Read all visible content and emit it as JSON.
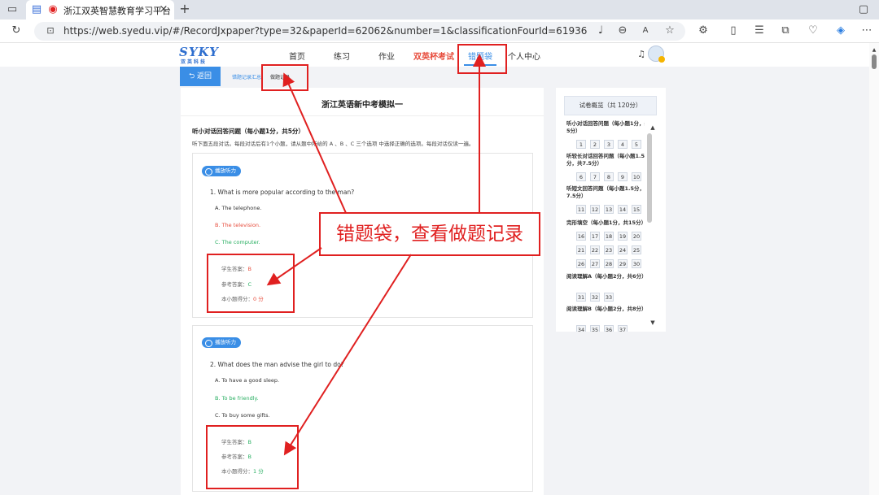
{
  "browser": {
    "tab_title": "浙江双英智慧教育学习平台",
    "new_tab": "+",
    "url": "https://web.syedu.vip/#/RecordJxpaper?type=32&paperId=62062&number=1&classificationFourId=61936"
  },
  "site": {
    "logo": "SYKY",
    "logo_sub": "双英科技",
    "nav": [
      "首页",
      "练习",
      "作业",
      "双英杯考试",
      "错题袋",
      "个人中心"
    ],
    "back_label": "返回",
    "crumb_summary": "错题记录汇总",
    "crumb_record": "做题记录"
  },
  "paper": {
    "title": "浙江英语新中考模拟一",
    "section_title": "听小对话回答问题（每小题1分，共5分）",
    "section_desc": "听下面五段对话。每段对话后有1个小题，请从题中所给的 A 、B 、C 三个选项 中选择正确的选项。每段对话仅读一遍。",
    "play_label": "播放听力",
    "questions": [
      {
        "text": "1. What is more popular according to the man?",
        "options": [
          "A. The telephone.",
          "B. The television.",
          "C. The computer."
        ],
        "student_label": "学生答案：",
        "student_answer": "B",
        "ref_label": "参考答案：",
        "ref_answer": "C",
        "score_label": "本小题得分：",
        "score": "0 分"
      },
      {
        "text": "2. What does the man advise the girl to do?",
        "options": [
          "A. To have a good sleep.",
          "B. To be friendly.",
          "C. To buy some gifts."
        ],
        "student_label": "学生答案：",
        "student_answer": "B",
        "ref_label": "参考答案：",
        "ref_answer": "B",
        "score_label": "本小题得分：",
        "score": "1 分"
      }
    ]
  },
  "panel": {
    "title": "试卷概览（共 120分）",
    "groups": [
      {
        "title": "听小对话回答问题（每小题1分，共5分）",
        "numbers": [
          "1",
          "2",
          "3",
          "4",
          "5"
        ]
      },
      {
        "title": "听较长对话回答问题（每小题1.5分，共7.5分）",
        "numbers": [
          "6",
          "7",
          "8",
          "9",
          "10"
        ]
      },
      {
        "title": "听短文回答问题（每小题1.5分，共7.5分）",
        "numbers": [
          "11",
          "12",
          "13",
          "14",
          "15"
        ]
      },
      {
        "title": "完形填空（每小题1分，共15分）",
        "numbers": [
          "16",
          "17",
          "18",
          "19",
          "20",
          "21",
          "22",
          "23",
          "24",
          "25",
          "26",
          "27",
          "28",
          "29",
          "30"
        ]
      },
      {
        "title": "阅读理解A（每小题2分，共6分）",
        "numbers": [
          "31",
          "32",
          "33"
        ]
      },
      {
        "title": "阅读理解B（每小题2分，共8分）",
        "numbers": [
          "34",
          "35",
          "36",
          "37"
        ]
      }
    ]
  },
  "annotation": {
    "callout": "错题袋，查看做题记录"
  },
  "colors": {
    "accent": "#3a8ee6",
    "wrong": "#e74c3c",
    "right": "#27ae60",
    "annotation": "#e02020"
  }
}
